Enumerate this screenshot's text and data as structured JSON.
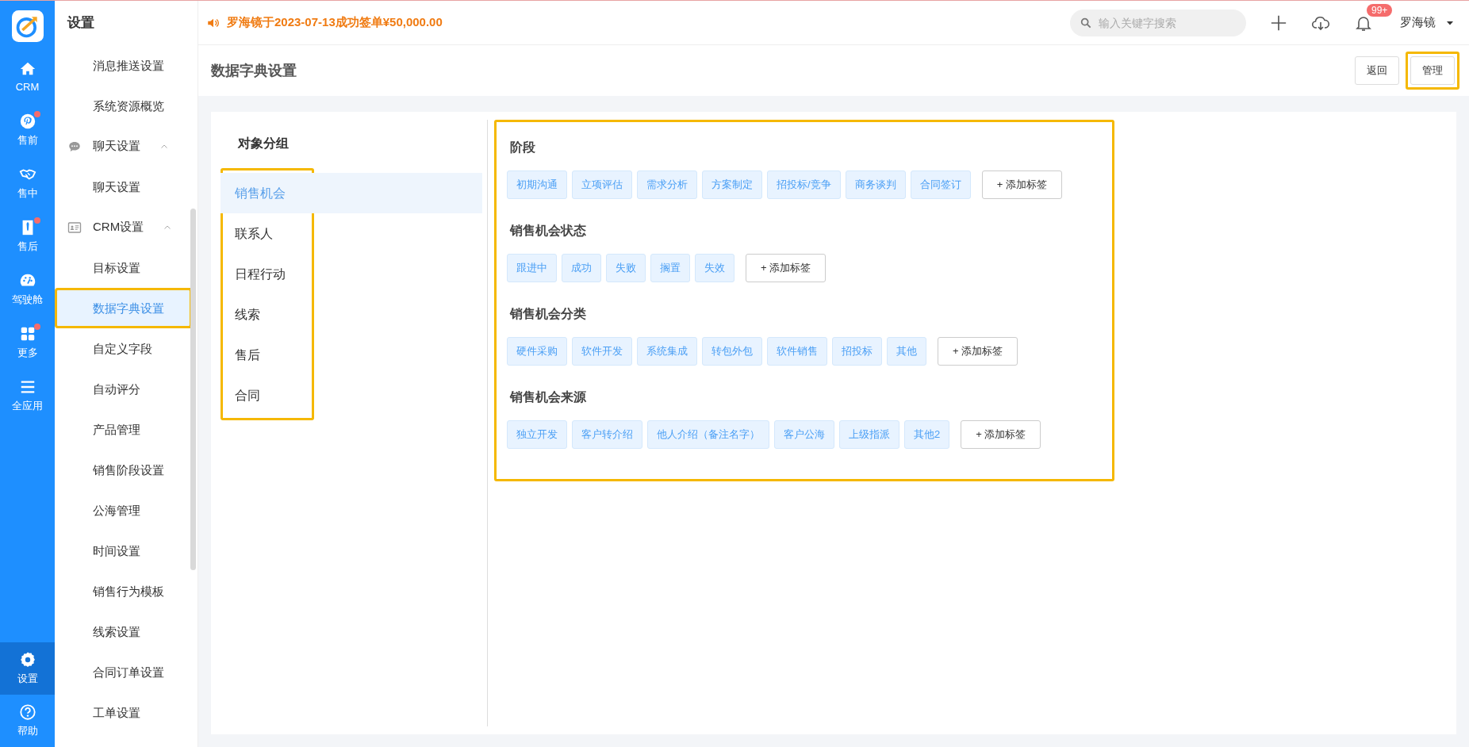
{
  "rail": {
    "items": [
      {
        "label": "CRM",
        "dot": false,
        "selected": false
      },
      {
        "label": "售前",
        "dot": true,
        "selected": false
      },
      {
        "label": "售中",
        "dot": false,
        "selected": false
      },
      {
        "label": "售后",
        "dot": true,
        "selected": false
      },
      {
        "label": "驾驶舱",
        "dot": false,
        "selected": false
      },
      {
        "label": "更多",
        "dot": true,
        "selected": false
      },
      {
        "label": "全应用",
        "dot": false,
        "selected": false
      }
    ],
    "bottom": [
      {
        "label": "设置",
        "selected": true
      },
      {
        "label": "帮助",
        "selected": false
      }
    ]
  },
  "sidebar": {
    "title": "设置",
    "items": [
      {
        "kind": "item",
        "label": "消息推送设置",
        "selected": false
      },
      {
        "kind": "item",
        "label": "系统资源概览",
        "selected": false
      },
      {
        "kind": "group",
        "label": "聊天设置",
        "expanded": true,
        "children": [
          {
            "kind": "item",
            "label": "聊天设置",
            "selected": false
          }
        ]
      },
      {
        "kind": "group",
        "label": "CRM设置",
        "expanded": true,
        "children": [
          {
            "kind": "item",
            "label": "目标设置",
            "selected": false
          },
          {
            "kind": "item",
            "label": "数据字典设置",
            "selected": true
          },
          {
            "kind": "item",
            "label": "自定义字段",
            "selected": false
          },
          {
            "kind": "item",
            "label": "自动评分",
            "selected": false
          },
          {
            "kind": "item",
            "label": "产品管理",
            "selected": false
          },
          {
            "kind": "item",
            "label": "销售阶段设置",
            "selected": false
          },
          {
            "kind": "item",
            "label": "公海管理",
            "selected": false
          },
          {
            "kind": "item",
            "label": "时间设置",
            "selected": false
          },
          {
            "kind": "item",
            "label": "销售行为模板",
            "selected": false
          },
          {
            "kind": "item",
            "label": "线索设置",
            "selected": false
          },
          {
            "kind": "item",
            "label": "合同订单设置",
            "selected": false
          },
          {
            "kind": "item",
            "label": "工单设置",
            "selected": false
          }
        ]
      }
    ]
  },
  "topbar": {
    "notice": "罗海镜于2023-07-13成功签单¥50,000.00",
    "search": {
      "placeholder": "输入关键字搜索"
    },
    "notification_count": "99+",
    "user": "罗海镜"
  },
  "page": {
    "title": "数据字典设置",
    "buttons": [
      "返回",
      "管理"
    ]
  },
  "groups": {
    "heading": "对象分组",
    "items": [
      {
        "label": "销售机会",
        "selected": true
      },
      {
        "label": "联系人",
        "selected": false
      },
      {
        "label": "日程行动",
        "selected": false
      },
      {
        "label": "线索",
        "selected": false
      },
      {
        "label": "售后",
        "selected": false
      },
      {
        "label": "合同",
        "selected": false
      }
    ]
  },
  "sections": [
    {
      "title": "阶段",
      "tags": [
        "初期沟通",
        "立项评估",
        "需求分析",
        "方案制定",
        "招投标/竞争",
        "商务谈判",
        "合同签订"
      ],
      "add_label": "+ 添加标签"
    },
    {
      "title": "销售机会状态",
      "tags": [
        "跟进中",
        "成功",
        "失败",
        "搁置",
        "失效"
      ],
      "add_label": "+ 添加标签"
    },
    {
      "title": "销售机会分类",
      "tags": [
        "硬件采购",
        "软件开发",
        "系统集成",
        "转包外包",
        "软件销售",
        "招投标",
        "其他"
      ],
      "add_label": "+ 添加标签"
    },
    {
      "title": "销售机会来源",
      "tags": [
        "独立开发",
        "客户转介绍",
        "他人介绍（备注名字）",
        "客户公海",
        "上级指派",
        "其他2"
      ],
      "add_label": "+ 添加标签"
    }
  ]
}
